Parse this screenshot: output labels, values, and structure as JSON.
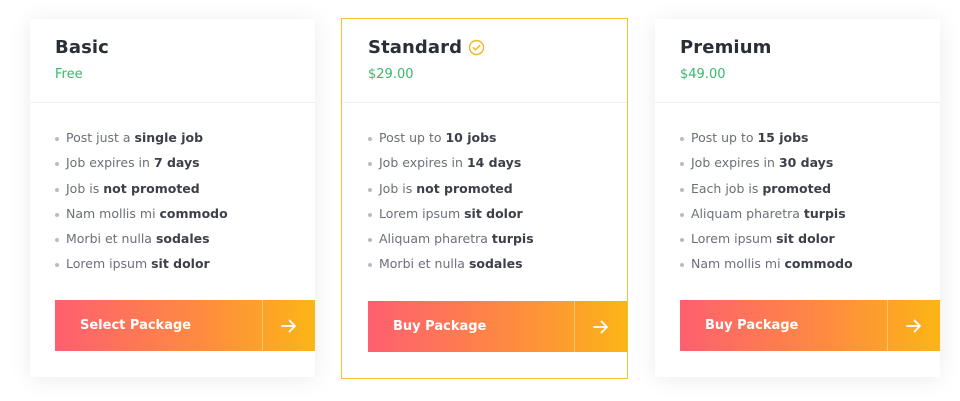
{
  "colors": {
    "price_green": "#37b86b",
    "featured_border": "#f2c230",
    "button_gradient_start": "#fe5f70",
    "button_gradient_end": "#fcb516"
  },
  "cards": [
    {
      "title": "Basic",
      "price": "Free",
      "featured": false,
      "features": [
        {
          "text": "Post just a ",
          "bold": "single job"
        },
        {
          "text": "Job expires in ",
          "bold": "7 days"
        },
        {
          "text": "Job is ",
          "bold": "not promoted"
        },
        {
          "text": "Nam mollis mi ",
          "bold": "commodo"
        },
        {
          "text": "Morbi et nulla ",
          "bold": "sodales"
        },
        {
          "text": "Lorem ipsum ",
          "bold": "sit dolor"
        }
      ],
      "button_label": "Select Package",
      "button_icon": "arrow-right-icon"
    },
    {
      "title": "Standard",
      "price": "$29.00",
      "featured": true,
      "featured_icon": "check-circle-icon",
      "features": [
        {
          "text": "Post up to ",
          "bold": "10 jobs"
        },
        {
          "text": "Job expires in ",
          "bold": "14 days"
        },
        {
          "text": "Job is ",
          "bold": "not promoted"
        },
        {
          "text": "Lorem ipsum ",
          "bold": "sit dolor"
        },
        {
          "text": "Aliquam pharetra ",
          "bold": "turpis"
        },
        {
          "text": "Morbi et nulla ",
          "bold": "sodales"
        }
      ],
      "button_label": "Buy Package",
      "button_icon": "arrow-right-icon"
    },
    {
      "title": "Premium",
      "price": "$49.00",
      "featured": false,
      "features": [
        {
          "text": "Post up to ",
          "bold": "15 jobs"
        },
        {
          "text": "Job expires in ",
          "bold": "30 days"
        },
        {
          "text": "Each job is ",
          "bold": "promoted"
        },
        {
          "text": "Aliquam pharetra ",
          "bold": "turpis"
        },
        {
          "text": "Lorem ipsum ",
          "bold": "sit dolor"
        },
        {
          "text": "Nam mollis mi ",
          "bold": "commodo"
        }
      ],
      "button_label": "Buy Package",
      "button_icon": "arrow-right-icon"
    }
  ]
}
